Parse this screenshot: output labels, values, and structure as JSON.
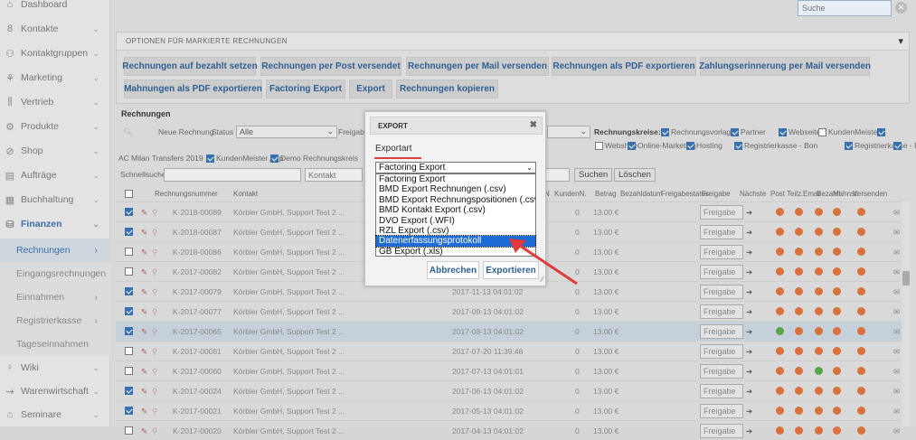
{
  "sidebar": {
    "items": [
      {
        "icon": "dashboard-icon",
        "glyph": "⌂",
        "label": "Dashboard",
        "chev": false
      },
      {
        "icon": "contacts-icon",
        "glyph": "8",
        "label": "Kontakte",
        "chev": true
      },
      {
        "icon": "contact-groups-icon",
        "glyph": "⚇",
        "label": "Kontaktgruppen",
        "chev": true
      },
      {
        "icon": "marketing-icon",
        "glyph": "⚘",
        "label": "Marketing",
        "chev": true
      },
      {
        "icon": "sales-icon",
        "glyph": "⫼",
        "label": "Vertrieb",
        "chev": true
      },
      {
        "icon": "products-icon",
        "glyph": "⚙",
        "label": "Produkte",
        "chev": true
      },
      {
        "icon": "shop-icon",
        "glyph": "⊘",
        "label": "Shop",
        "chev": true
      },
      {
        "icon": "orders-icon",
        "glyph": "▤",
        "label": "Aufträge",
        "chev": true
      },
      {
        "icon": "accounting-icon",
        "glyph": "▦",
        "label": "Buchhaltung",
        "chev": true
      },
      {
        "icon": "finance-icon",
        "glyph": "⛁",
        "label": "Finanzen",
        "chev": true
      }
    ],
    "sub_items": [
      "Rechnungen",
      "Eingangsrechnungen",
      "Einnahmen",
      "Registrierkasse",
      "Tageseinnahmen"
    ],
    "bottom_items": [
      {
        "icon": "wiki-icon",
        "glyph": "♀",
        "label": "Wiki"
      },
      {
        "icon": "inventory-icon",
        "glyph": "⇝",
        "label": "Warenwirtschaft"
      },
      {
        "icon": "seminars-icon",
        "glyph": "⌂",
        "label": "Seminare"
      }
    ]
  },
  "search": {
    "placeholder": "Suche"
  },
  "options_panel": {
    "title": "OPTIONEN FÜR MARKIERTE RECHNUNGEN",
    "buttons_row1": [
      "Rechnungen auf bezahlt setzen",
      "Rechnungen per Post versendet",
      "Rechnungen per Mail versenden",
      "Rechnungen als PDF exportieren",
      "Zahlungserinnerung per Mail versenden"
    ],
    "buttons_row2": [
      "Mahnungen als PDF exportieren",
      "Factoring Export",
      "Export",
      "Rechnungen kopieren"
    ]
  },
  "list": {
    "title": "Rechnungen",
    "new_label": "Neue Rechnung",
    "status_label": "Status",
    "status_value": "Alle",
    "freigabe_label": "Freigabe",
    "kreise_label": "Rechnungskreise:",
    "kreise": [
      "Rechnungsvorlage",
      "Partner",
      "Webseiten",
      "KundenMeister",
      "Webshop",
      "Online-Marketing",
      "Hosting",
      "Registrierkasse - Bon",
      "Registrierkasse - Bon"
    ],
    "kreise_row3": [
      "AC Milan Transfers 2019",
      "KundenMeister App",
      "Demo Rechnungskreis"
    ],
    "quicksearch_label": "Schnellsuche",
    "kontakt_placeholder": "Kontakt",
    "search_button": "Suchen",
    "clear_button": "Löschen"
  },
  "table": {
    "headers": [
      "Rechnungsnummer",
      "Kontakt",
      "N",
      "KundenN.",
      "Betrag",
      "Bezahldatum",
      "Freigabestatus",
      "Freigabe",
      "Nächste",
      "Post",
      "Teilz.",
      "Email",
      "Bezahlt",
      "Mahnst.",
      "Versenden"
    ],
    "freigabe_button": "Freigabe",
    "rows": [
      {
        "checked": true,
        "nr": "K-2018-00089",
        "kontakt": "Körbler GmbH, Support Test 2 ...",
        "date": "",
        "n": "0",
        "betrag": "13.00 €",
        "dots": [
          "r",
          "r",
          "r",
          "r",
          "r"
        ]
      },
      {
        "checked": true,
        "nr": "K-2018-00087",
        "kontakt": "Körbler GmbH, Support Test 2 ...",
        "date": "",
        "n": "0",
        "betrag": "13.00 €",
        "dots": [
          "r",
          "r",
          "r",
          "r",
          "r"
        ]
      },
      {
        "checked": false,
        "nr": "K-2018-00086",
        "kontakt": "Körbler GmbH, Support Test 2 ...",
        "date": "",
        "n": "0",
        "betrag": "13.00 €",
        "dots": [
          "r",
          "r",
          "r",
          "r",
          "r"
        ]
      },
      {
        "checked": false,
        "nr": "K-2017-00082",
        "kontakt": "Körbler GmbH, Support Test 2 ...",
        "date": "",
        "n": "0",
        "betrag": "13.00 €",
        "dots": [
          "r",
          "r",
          "r",
          "r",
          "r"
        ]
      },
      {
        "checked": true,
        "nr": "K-2017-00079",
        "kontakt": "Körbler GmbH, Support Test 2 ...",
        "date": "2017-11-13 04:01:02",
        "n": "0",
        "betrag": "13.00 €",
        "dots": [
          "r",
          "r",
          "r",
          "r",
          "r"
        ]
      },
      {
        "checked": true,
        "nr": "K-2017-00077",
        "kontakt": "Körbler GmbH, Support Test 2 ...",
        "date": "2017-09-13 04:01:02",
        "n": "0",
        "betrag": "13.00 €",
        "dots": [
          "r",
          "r",
          "r",
          "r",
          "r"
        ]
      },
      {
        "checked": true,
        "nr": "K-2017-00065",
        "kontakt": "Körbler GmbH, Support Test 2 ...",
        "date": "2017-08-13 04:01:02",
        "n": "0",
        "betrag": "13.00 €",
        "dots": [
          "g",
          "r",
          "r",
          "r",
          "r"
        ],
        "highlight": true
      },
      {
        "checked": false,
        "nr": "K-2017-00061",
        "kontakt": "Körbler GmbH, Support Test 2 ...",
        "date": "2017-07-20 11:39:48",
        "n": "0",
        "betrag": "13.00 €",
        "dots": [
          "r",
          "r",
          "r",
          "r",
          "r"
        ]
      },
      {
        "checked": false,
        "nr": "K-2017-00060",
        "kontakt": "Körbler GmbH, Support Test 2 ...",
        "date": "2017-07-13 04:01:01",
        "n": "0",
        "betrag": "13.00 €",
        "dots": [
          "r",
          "r",
          "g",
          "r",
          "r"
        ]
      },
      {
        "checked": true,
        "nr": "K-2017-00024",
        "kontakt": "Körbler GmbH, Support Test 2 ...",
        "date": "2017-06-13 04:01:02",
        "n": "0",
        "betrag": "13.00 €",
        "dots": [
          "r",
          "r",
          "r",
          "r",
          "r"
        ]
      },
      {
        "checked": true,
        "nr": "K-2017-00021",
        "kontakt": "Körbler GmbH, Support Test 2 ...",
        "date": "2017-05-13 04:01:02",
        "n": "0",
        "betrag": "13.00 €",
        "dots": [
          "r",
          "r",
          "r",
          "r",
          "r"
        ]
      },
      {
        "checked": false,
        "nr": "K-2017-00020",
        "kontakt": "Körbler GmbH, Support Test 2 ...",
        "date": "2017-04-13 04:01:02",
        "n": "0",
        "betrag": "13.00 €",
        "dots": [
          "r",
          "r",
          "r",
          "r",
          "r"
        ]
      }
    ]
  },
  "dialog": {
    "title": "EXPORT",
    "close": "✖",
    "label": "Exportart",
    "selected": "Factoring Export",
    "options": [
      "Factoring Export",
      "BMD Export Rechnungen (.csv)",
      "BMD Export Rechnungspositionen (.csv)",
      "BMD Kontakt Export (.csv)",
      "DVO Export (.WFI)",
      "RZL Export (.csv)",
      "Datenerfassungsprotokoll",
      "GB Export (.xls)"
    ],
    "highlighted_option": 6,
    "cancel": "Abbrechen",
    "export": "Exportieren"
  },
  "colors": {
    "accent": "#2f5f93",
    "highlight": "#1e6dd6",
    "annotation": "#e03a3a"
  }
}
